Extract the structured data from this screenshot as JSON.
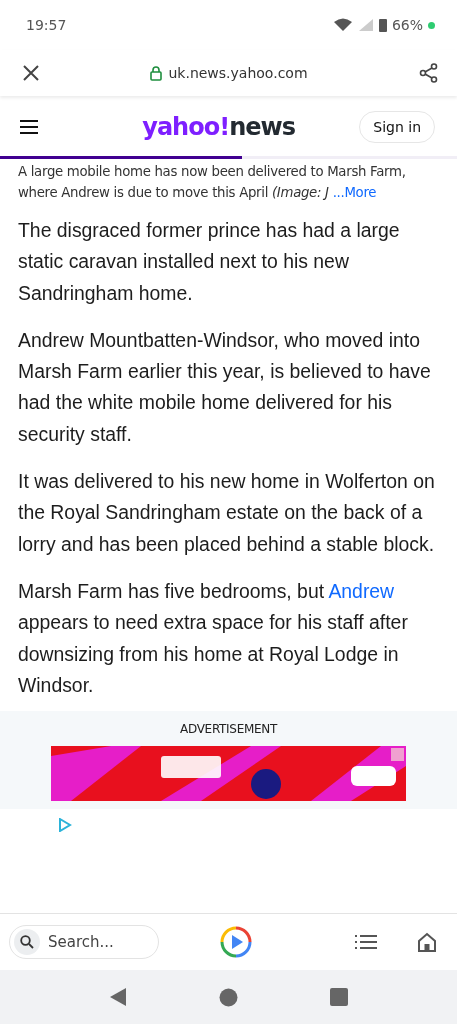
{
  "status_bar": {
    "time": "19:57",
    "battery": "66%"
  },
  "browser_bar": {
    "url": "uk.news.yahoo.com"
  },
  "site_header": {
    "logo_brand": "yahoo!",
    "logo_section": "news",
    "sign_in": "Sign in",
    "reading_progress": {
      "level": 0.53
    }
  },
  "caption": {
    "text": "A large mobile home has now been delivered to Marsh Farm, where Andrew is due to move this April *(Image: J*",
    "more_link": "...More"
  },
  "paragraphs": [
    [
      {
        "kind": "text",
        "text": "The disgraced former prince has had a large static caravan installed next to his new Sandringham home."
      }
    ],
    [
      {
        "kind": "text",
        "text": "Andrew Mountbatten-Windsor, who moved into Marsh Farm earlier this year, is believed to have had the white mobile home delivered for his security staff."
      }
    ],
    [
      {
        "kind": "text",
        "text": "It was delivered to his new home in Wolferton on the Royal Sandringham estate on the back of a lorry and has been placed behind a stable block."
      }
    ],
    [
      {
        "kind": "text",
        "text": "Marsh Farm has five bedrooms, but "
      },
      {
        "kind": "link",
        "text": "Andrew"
      },
      {
        "kind": "text",
        "text": " appears to need extra space for his staff after downsizing from his home at Royal Lodge in Windsor."
      }
    ]
  ],
  "advertisement": {
    "label": "ADVERTISEMENT"
  },
  "bottom_toolbar": {
    "search_placeholder": "Search..."
  }
}
